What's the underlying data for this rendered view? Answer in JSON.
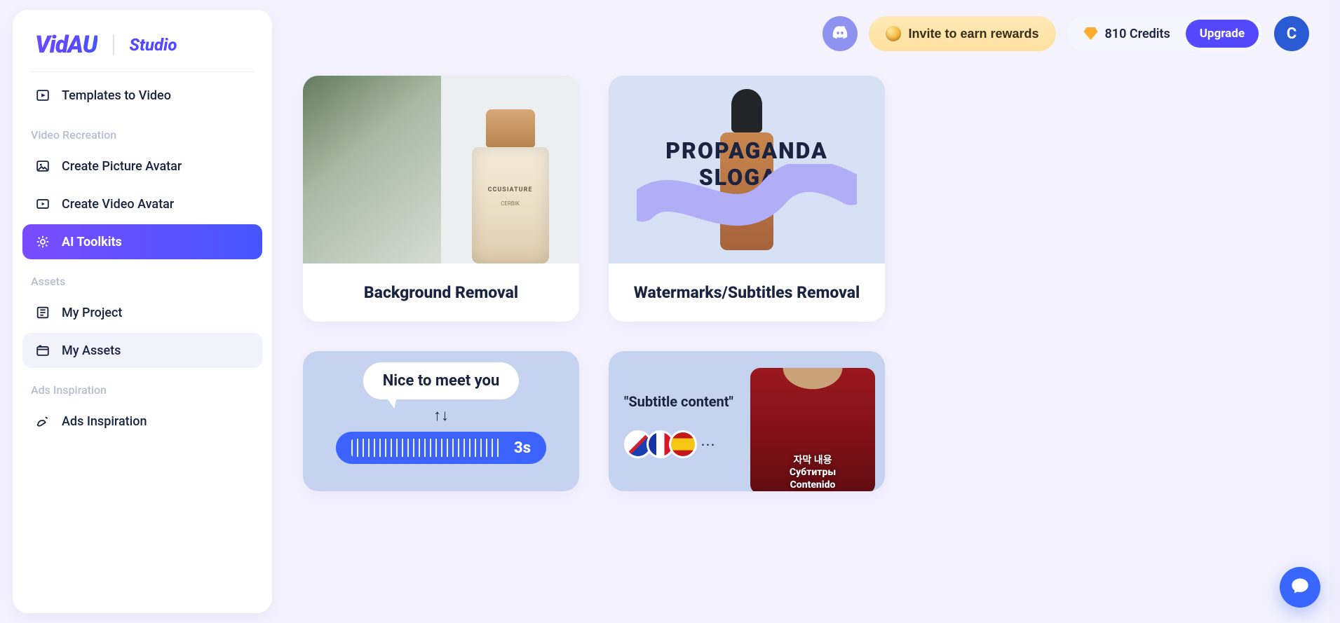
{
  "logo": {
    "main": "VidAU",
    "studio": "Studio"
  },
  "sidebar": {
    "top_items": [
      {
        "label": "Templates to Video"
      }
    ],
    "sections": [
      {
        "label": "Video Recreation",
        "items": [
          {
            "label": "Create Picture Avatar"
          },
          {
            "label": "Create Video Avatar"
          },
          {
            "label": "AI Toolkits",
            "active": true
          }
        ]
      },
      {
        "label": "Assets",
        "items": [
          {
            "label": "My Project"
          },
          {
            "label": "My Assets",
            "hovered": true
          }
        ]
      },
      {
        "label": "Ads Inspiration",
        "items": [
          {
            "label": "Ads Inspiration"
          }
        ]
      }
    ]
  },
  "header": {
    "invite_label": "Invite to earn rewards",
    "credits_value": "810 Credits",
    "upgrade_label": "Upgrade",
    "avatar_initial": "C"
  },
  "tools": {
    "row1": [
      {
        "title": "Background Removal",
        "thumb": "perfume",
        "bottle_label1": "CCUSIATURE",
        "bottle_label2": "CERBIK"
      },
      {
        "title": "Watermarks/Subtitles Removal",
        "thumb": "propaganda",
        "line1": "PROPAGANDA",
        "line2": "SLOGAN"
      }
    ],
    "row2": [
      {
        "thumb": "nice",
        "speech": "Nice to meet you",
        "arrows": "↑↓",
        "duration": "3s"
      },
      {
        "thumb": "subtitle",
        "quote": "\"Subtitle content\"",
        "flags_more": "···",
        "sub_line1": "자막 내용",
        "sub_line2": "Субтитры",
        "sub_line3": "Contenido"
      }
    ]
  }
}
